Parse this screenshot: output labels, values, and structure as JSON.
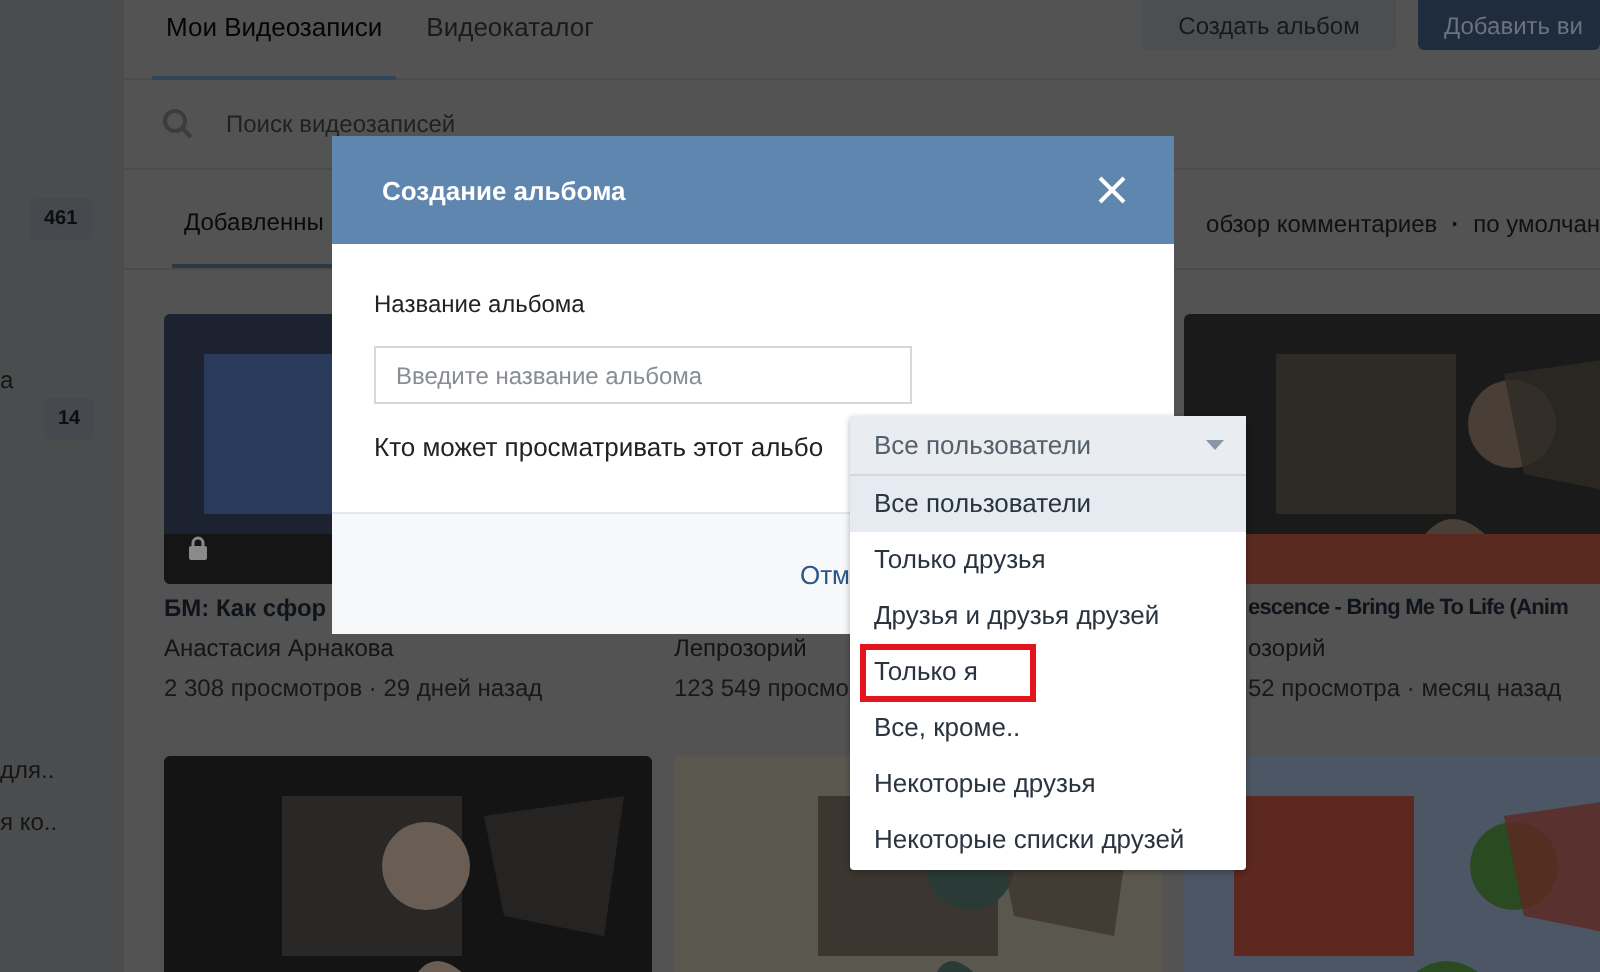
{
  "sidebar": [
    {
      "kind": "count",
      "text": "461"
    },
    {
      "kind": "text",
      "text": "а"
    },
    {
      "kind": "count",
      "text": "14"
    },
    {
      "kind": "text",
      "text": "для.."
    },
    {
      "kind": "text",
      "text": "я ко.."
    }
  ],
  "tabs": [
    {
      "label": "Мои Видеозаписи",
      "selected": true
    },
    {
      "label": "Видеокаталог",
      "selected": false
    }
  ],
  "buttons": [
    {
      "label": "Создать альбом",
      "kind": "secondary"
    },
    {
      "label": "Добавить ви",
      "kind": "primary"
    }
  ],
  "search": {
    "placeholder": "Поиск видеозаписей"
  },
  "filters": [
    {
      "label": "Добавленны",
      "selected": true
    }
  ],
  "sort": {
    "items": [
      "обзор комментариев",
      "по умолчан"
    ],
    "separator": "·"
  },
  "videos": [
    {
      "kind": "picture",
      "title": "БМ: Как сфор",
      "author": "Анастасия Арнакова",
      "meta": "2 308 просмотров · 29 дней назад",
      "locked": true
    },
    {
      "author": "Лепрозорий",
      "meta": "123 549 просмо"
    },
    {
      "kind": "picture",
      "title": "escence - Bring Me To Life (Anim",
      "author": "озорий",
      "meta": "52 просмотра · месяц назад"
    },
    {
      "kind": "picture"
    },
    {
      "kind": "picture"
    },
    {
      "kind": "picture"
    }
  ],
  "dialog": {
    "title": "Создание альбома",
    "name_label": "Название альбома",
    "name_field": {
      "placeholder": "Введите название альбома"
    },
    "privacy_label": "Кто может просматривать этот альбо",
    "privacy": {
      "value": "Все пользователи",
      "options": [
        {
          "label": "Все пользователи",
          "selected": true,
          "marked": false
        },
        {
          "label": "Только друзья",
          "selected": false,
          "marked": false
        },
        {
          "label": "Друзья и друзья друзей",
          "selected": false,
          "marked": false
        },
        {
          "label": "Только я",
          "selected": false,
          "marked": true
        },
        {
          "label": "Все, кроме..",
          "selected": false,
          "marked": false
        },
        {
          "label": "Некоторые друзья",
          "selected": false,
          "marked": false
        },
        {
          "label": "Некоторые списки друзей",
          "selected": false,
          "marked": false
        }
      ]
    },
    "footer_buttons": [
      "Отм"
    ]
  }
}
